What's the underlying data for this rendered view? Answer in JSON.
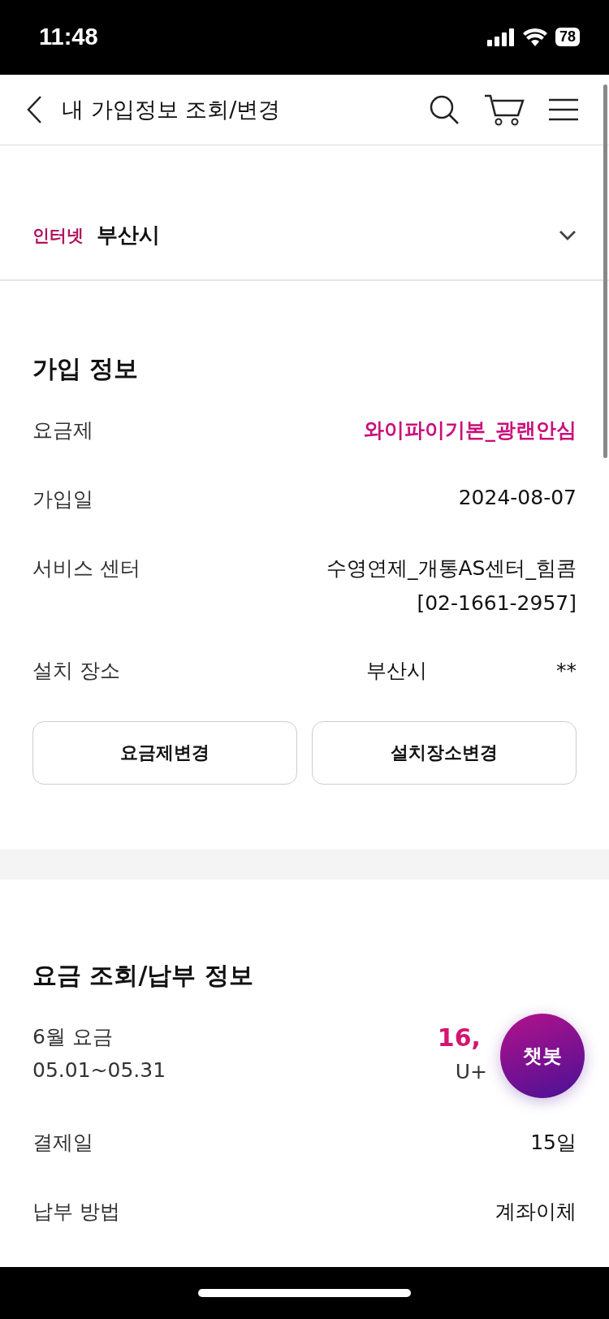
{
  "status_bar": {
    "time": "11:48",
    "battery": "78"
  },
  "header": {
    "title": "내 가입정보 조회/변경"
  },
  "service": {
    "type": "인터넷",
    "address": "부산시"
  },
  "subscription": {
    "title": "가입 정보",
    "rows": [
      {
        "label": "요금제",
        "value": [
          "와이파이기본_광랜안심"
        ],
        "highlight": true
      },
      {
        "label": "가입일",
        "value": [
          "2024-08-07"
        ],
        "highlight": false
      },
      {
        "label": "서비스 센터",
        "value": [
          "수영연제_개통AS센터_힘콤",
          "[02-1661-2957]"
        ],
        "highlight": false
      },
      {
        "label": "설치 장소",
        "value": [
          "부산시                    **"
        ],
        "highlight": false
      }
    ],
    "buttons": [
      "요금제변경",
      "설치장소변경"
    ]
  },
  "billing": {
    "title": "요금 조회/납부 정보",
    "month": {
      "label": "6월 요금",
      "period": "05.01~05.31",
      "amount": "16,",
      "product": "U+"
    },
    "rows": [
      {
        "label": "결제일",
        "value": "15일"
      },
      {
        "label": "납부 방법",
        "value": "계좌이체"
      }
    ]
  },
  "chatbot": {
    "label": "챗봇"
  }
}
